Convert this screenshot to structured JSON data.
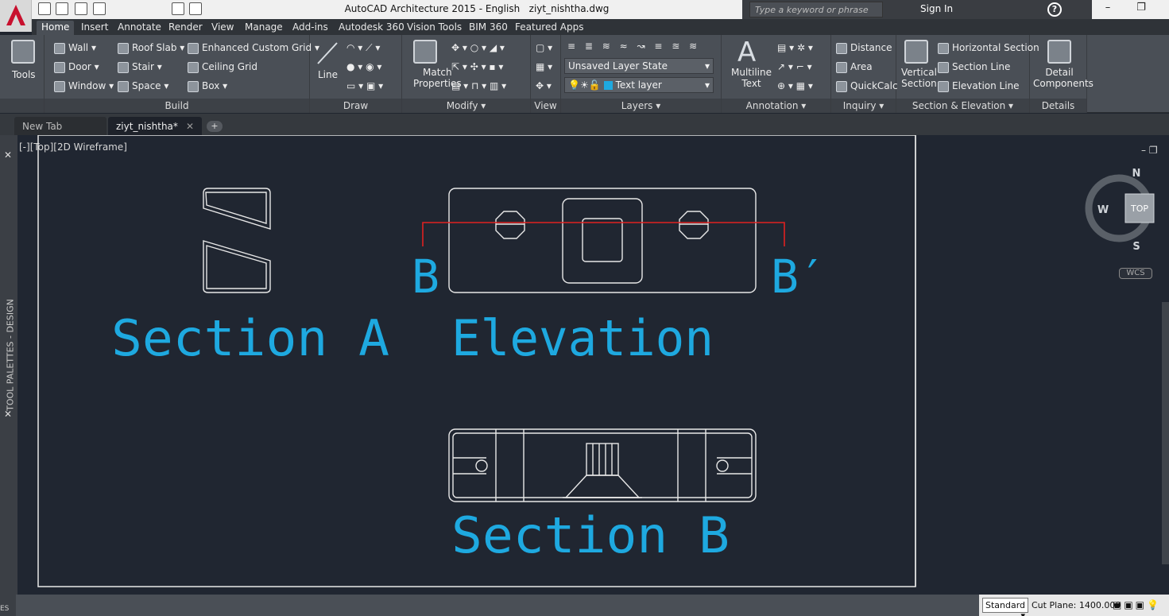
{
  "titlebar": {
    "app": "AutoCAD Architecture 2015 - English",
    "file": "ziyt_nishtha.dwg",
    "search_placeholder": "Type a keyword or phrase",
    "signin": "Sign In",
    "help": "?"
  },
  "ribbon_tabs": [
    "Home",
    "Insert",
    "Annotate",
    "Render",
    "View",
    "Manage",
    "Add-ins",
    "Autodesk 360",
    "Vision Tools",
    "BIM 360",
    "Featured Apps"
  ],
  "panels": {
    "tools": {
      "label": "Tools"
    },
    "build": {
      "title": "Build",
      "items": [
        "Wall",
        "Door",
        "Window",
        "Roof Slab",
        "Stair",
        "Space",
        "Enhanced Custom Grid",
        "Ceiling Grid",
        "Box"
      ]
    },
    "draw": {
      "title": "Draw",
      "line": "Line"
    },
    "modify": {
      "title": "Modify",
      "match": "Match",
      "properties": "Properties"
    },
    "view": {
      "title": "View"
    },
    "layers": {
      "title": "Layers",
      "state": "Unsaved Layer State",
      "layer": "Text layer"
    },
    "annotation": {
      "title": "Annotation",
      "multiline": "Multiline",
      "text": "Text"
    },
    "inquiry": {
      "title": "Inquiry",
      "distance": "Distance",
      "area": "Area",
      "quickcalc": "QuickCalc"
    },
    "section": {
      "title": "Section & Elevation",
      "vertical": "Vertical",
      "section": "Section",
      "horizontal": "Horizontal Section",
      "section_line": "Section Line",
      "elevation_line": "Elevation Line"
    },
    "details": {
      "title": "Details",
      "detail": "Detail",
      "components": "Components"
    }
  },
  "doc_tabs": {
    "new_tab": "New Tab",
    "active": "ziyt_nishtha*"
  },
  "viewport": {
    "label": "[-][Top][2D Wireframe]",
    "palette": "TOOL PALETTES - DESIGN"
  },
  "drawing": {
    "section_a": "Section A",
    "elevation": "Elevation",
    "section_b": "Section B",
    "marker_b": "B",
    "marker_b_prime": "B′"
  },
  "viewcube": {
    "n": "N",
    "s": "S",
    "w": "W",
    "top": "TOP",
    "wcs": "WCS"
  },
  "status": {
    "style": "Standard",
    "cut_plane": "Cut Plane: 1400.000",
    "left": "ES"
  },
  "colors": {
    "cyan": "#1ea9e0",
    "red": "#e02020",
    "white": "#e8e8e8"
  }
}
